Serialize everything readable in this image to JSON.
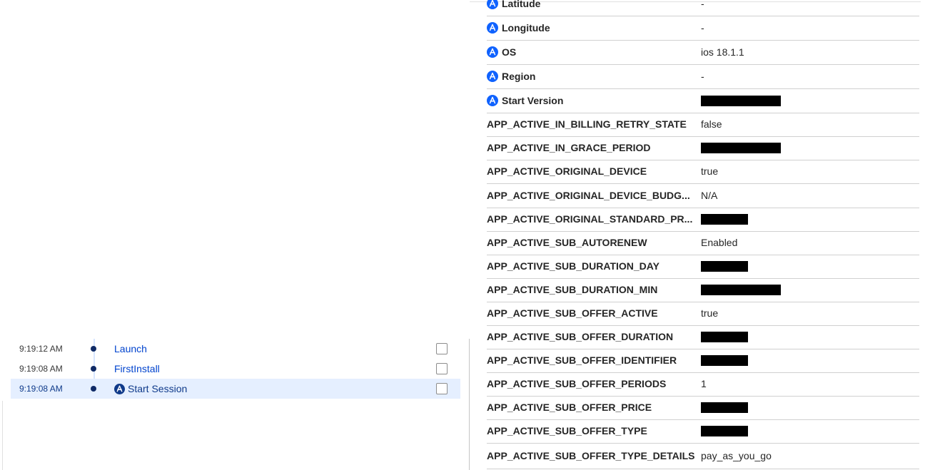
{
  "timeline": {
    "events": [
      {
        "time": "9:19:12 AM",
        "name": "Launch",
        "has_icon": false,
        "selected": false
      },
      {
        "time": "9:19:08 AM",
        "name": "FirstInstall",
        "has_icon": false,
        "selected": false
      },
      {
        "time": "9:19:08 AM",
        "name": "Start Session",
        "has_icon": true,
        "selected": true
      }
    ]
  },
  "properties": [
    {
      "key": "Latitude",
      "value": "-",
      "icon": "app-store-icon",
      "redacted": false
    },
    {
      "key": "Longitude",
      "value": "-",
      "icon": "app-store-icon",
      "redacted": false
    },
    {
      "key": "OS",
      "value": "ios 18.1.1",
      "icon": "app-store-icon",
      "redacted": false
    },
    {
      "key": "Region",
      "value": "-",
      "icon": "app-store-icon",
      "redacted": false
    },
    {
      "key": "Start Version",
      "value": "",
      "icon": "app-store-icon",
      "redacted": true
    },
    {
      "key": "APP_ACTIVE_IN_BILLING_RETRY_STATE",
      "value": "false",
      "redacted": false
    },
    {
      "key": "APP_ACTIVE_IN_GRACE_PERIOD",
      "value": "",
      "redacted": true
    },
    {
      "key": "APP_ACTIVE_ORIGINAL_DEVICE",
      "value": "true",
      "redacted": false
    },
    {
      "key": "APP_ACTIVE_ORIGINAL_DEVICE_BUDG...",
      "value": "N/A",
      "redacted": false
    },
    {
      "key": "APP_ACTIVE_ORIGINAL_STANDARD_PR...",
      "value": "",
      "redacted": true
    },
    {
      "key": "APP_ACTIVE_SUB_AUTORENEW",
      "value": "Enabled",
      "redacted": false
    },
    {
      "key": "APP_ACTIVE_SUB_DURATION_DAY",
      "value": "",
      "redacted": true
    },
    {
      "key": "APP_ACTIVE_SUB_DURATION_MIN",
      "value": "",
      "redacted": true
    },
    {
      "key": "APP_ACTIVE_SUB_OFFER_ACTIVE",
      "value": "true",
      "redacted": false
    },
    {
      "key": "APP_ACTIVE_SUB_OFFER_DURATION",
      "value": "",
      "redacted": true
    },
    {
      "key": "APP_ACTIVE_SUB_OFFER_IDENTIFIER",
      "value": "",
      "redacted": true
    },
    {
      "key": "APP_ACTIVE_SUB_OFFER_PERIODS",
      "value": "1",
      "redacted": false
    },
    {
      "key": "APP_ACTIVE_SUB_OFFER_PRICE",
      "value": "",
      "redacted": true
    },
    {
      "key": "APP_ACTIVE_SUB_OFFER_TYPE",
      "value": "",
      "redacted": true
    },
    {
      "key": "APP_ACTIVE_SUB_OFFER_TYPE_DETAILS",
      "value": "pay_as_you_go",
      "redacted": false
    }
  ]
}
